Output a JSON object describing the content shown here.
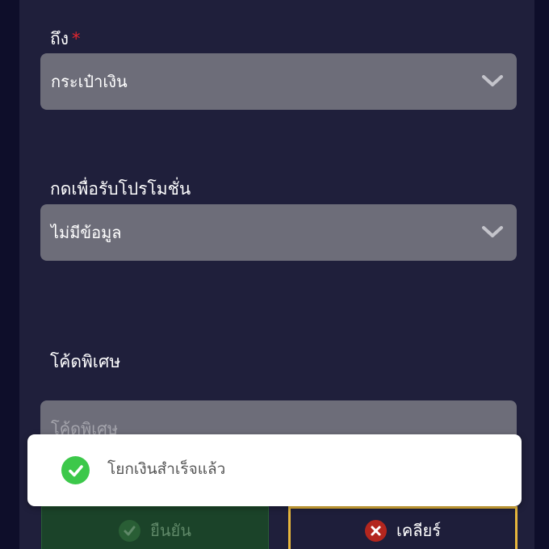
{
  "form": {
    "to": {
      "label": "ถึง",
      "required_mark": "*",
      "value": "กระเป๋าเงิน"
    },
    "promotion": {
      "label": "กดเพื่อรับโปรโมชั่น",
      "value": "ไม่มีข้อมูล"
    },
    "special_code": {
      "label": "โค้ดพิเศษ",
      "placeholder": "โค้ดพิเศษ",
      "value": ""
    }
  },
  "buttons": {
    "confirm_label": "ยืนยัน",
    "clear_label": "เคลียร์"
  },
  "toast": {
    "message": "โยกเงินสำเร็จแล้ว"
  },
  "icons": {
    "select_arrow": "chevron-down-icon",
    "confirm": "check-circle-icon",
    "clear": "close-circle-icon",
    "toast": "check-circle-icon"
  },
  "colors": {
    "panel_background": "#1f1f3b",
    "field_background": "#6d6d79",
    "required": "#e0262f",
    "confirm_button": "#1b4a26",
    "clear_border": "#e6b63c",
    "clear_icon": "#b3261e",
    "success": "#3cc84a"
  }
}
